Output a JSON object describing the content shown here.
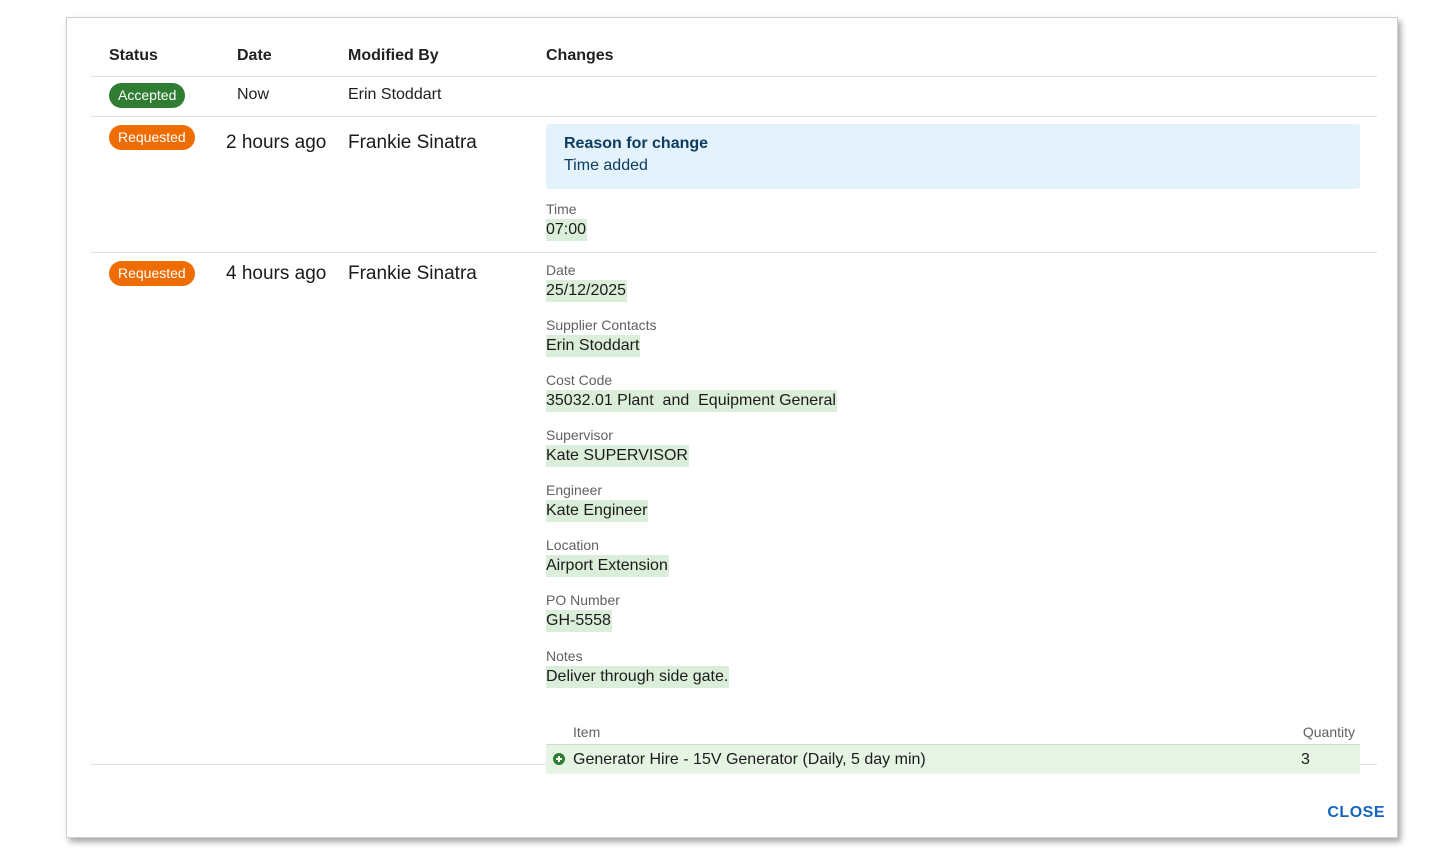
{
  "table": {
    "headers": {
      "status": "Status",
      "date": "Date",
      "modified_by": "Modified By",
      "changes": "Changes"
    },
    "rows": [
      {
        "status": "Accepted",
        "date": "Now",
        "modified_by": "Erin Stoddart"
      },
      {
        "status": "Requested",
        "date": "2 hours ago",
        "modified_by": "Frankie Sinatra",
        "reason": {
          "title": "Reason for change",
          "text": "Time added"
        },
        "fields": [
          {
            "label": "Time",
            "value": "07:00"
          }
        ]
      },
      {
        "status": "Requested",
        "date": "4 hours ago",
        "modified_by": "Frankie Sinatra",
        "fields": [
          {
            "label": "Date",
            "value": "25/12/2025"
          },
          {
            "label": "Supplier Contacts",
            "value": "Erin Stoddart"
          },
          {
            "label": "Cost Code",
            "value": "35032.01 Plant  and  Equipment General"
          },
          {
            "label": "Supervisor",
            "value": "Kate SUPERVISOR"
          },
          {
            "label": "Engineer",
            "value": "Kate Engineer"
          },
          {
            "label": "Location",
            "value": "Airport Extension"
          },
          {
            "label": "PO Number",
            "value": "GH-5558"
          },
          {
            "label": "Notes",
            "value": "Deliver through side gate."
          }
        ],
        "items": {
          "header_item": "Item",
          "header_quantity": "Quantity",
          "rows": [
            {
              "item": "Generator Hire - 15V Generator (Daily, 5 day min)",
              "quantity": "3",
              "icon": "plus-circle-icon"
            }
          ]
        }
      }
    ]
  },
  "close_label": "CLOSE",
  "colors": {
    "accepted": "#2e7d32",
    "requested": "#ef6c00",
    "reason_bg": "#e3f2fb",
    "changed_bg": "#dbeed9",
    "link": "#1565c0"
  }
}
